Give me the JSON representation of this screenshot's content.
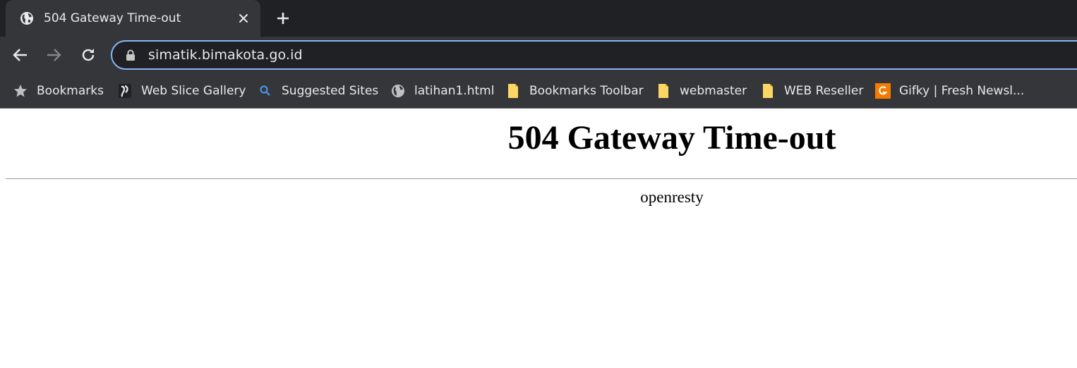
{
  "tab": {
    "title": "504 Gateway Time-out",
    "favicon": "globe-icon"
  },
  "omnibox": {
    "url": "simatik.bimakota.go.id"
  },
  "bookmarks": [
    {
      "label": "Bookmarks",
      "icon": "star-icon"
    },
    {
      "label": "Web Slice Gallery",
      "icon": "web-slice-icon"
    },
    {
      "label": "Suggested Sites",
      "icon": "search-icon"
    },
    {
      "label": "latihan1.html",
      "icon": "globe-icon"
    },
    {
      "label": "Bookmarks Toolbar",
      "icon": "folder-icon"
    },
    {
      "label": "webmaster",
      "icon": "folder-icon"
    },
    {
      "label": "WEB Reseller",
      "icon": "folder-icon"
    },
    {
      "label": "Gifky | Fresh Newsl...",
      "icon": "gifky-icon"
    }
  ],
  "page": {
    "heading": "504 Gateway Time-out",
    "server": "openresty"
  },
  "colors": {
    "tabstrip": "#202124",
    "toolbar": "#35363a",
    "omnibox_border": "#8ab4f8",
    "folder": "#fdd663",
    "gifky": "#f57c00"
  }
}
